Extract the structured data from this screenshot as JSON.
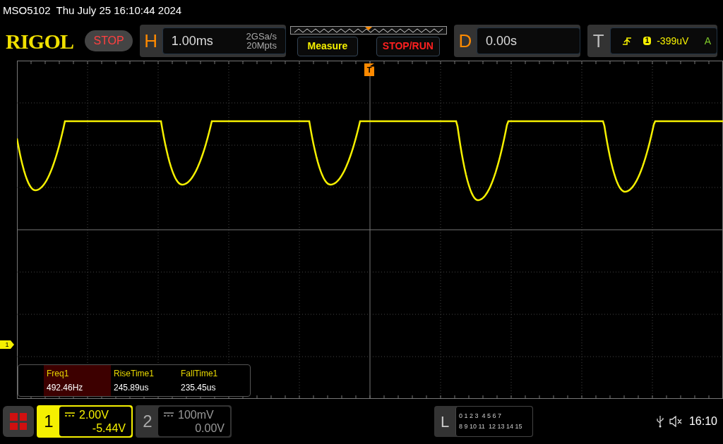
{
  "title_bar": {
    "model": "MSO5102",
    "datetime": "Thu July 25 16:10:44 2024"
  },
  "toolbar": {
    "logo": "RIGOL",
    "run_state": {
      "label": "STOP",
      "stopped": true
    },
    "horizontal": {
      "label": "H",
      "timebase": "1.00ms",
      "sample_rate": "2GSa/s",
      "memory_depth": "20Mpts"
    },
    "buttons": [
      {
        "label": "Measure",
        "kind": "measure"
      },
      {
        "label": "STOP/RUN",
        "kind": "run"
      }
    ],
    "delay": {
      "label": "D",
      "value": "0.00s"
    },
    "trigger": {
      "label": "T",
      "source": "1",
      "level": "-399uV",
      "mode": "A"
    }
  },
  "screen": {
    "trigger_marker": "T",
    "channel_marker": "1"
  },
  "measurements": [
    {
      "name": "Freq1",
      "value": "492.46Hz",
      "selected": true
    },
    {
      "name": "RiseTime1",
      "value": "245.89us",
      "selected": false
    },
    {
      "name": "FallTime1",
      "value": "235.45us",
      "selected": false
    }
  ],
  "channels": [
    {
      "number": "1",
      "scale": "2.00V",
      "offset": "-5.44V",
      "on": true
    },
    {
      "number": "2",
      "scale": "100mV",
      "offset": "0.00V",
      "on": false
    }
  ],
  "logic": {
    "label": "L",
    "rows": [
      [
        "0 1 2 3",
        "4 5 6 7"
      ],
      [
        "8 9 10 11",
        "12 13 14 15"
      ]
    ]
  },
  "status_bar": {
    "time": "16:10"
  }
}
